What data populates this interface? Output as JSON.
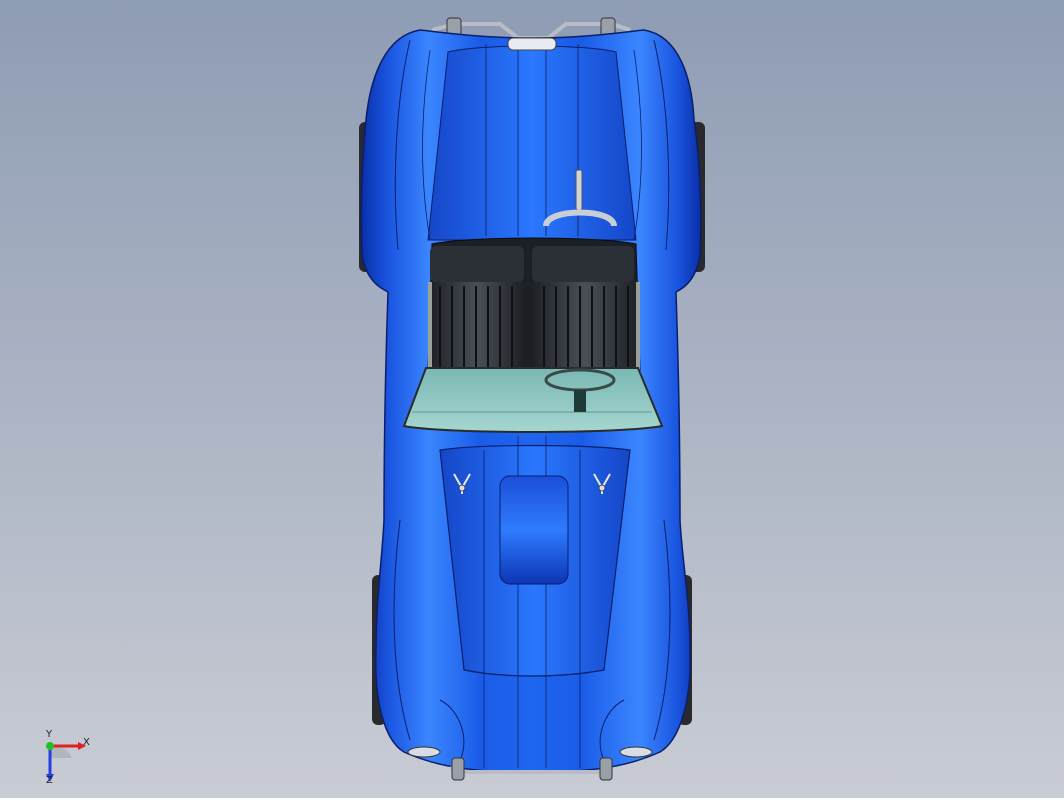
{
  "scene": {
    "background_top": "#8e9cb4",
    "background_bottom": "#c9ccd4",
    "model": "car-top-view",
    "body_color": "#1560e0",
    "body_dark": "#0a2fa8",
    "body_light": "#6fb2ff",
    "glass_color": "#8fc9c4",
    "seat_color": "#2a2d33"
  },
  "triad": {
    "x_label": "X",
    "y_label": "Y",
    "z_label": "Z",
    "x_color": "#e02020",
    "y_color": "#20c020",
    "z_color": "#2040e0"
  }
}
